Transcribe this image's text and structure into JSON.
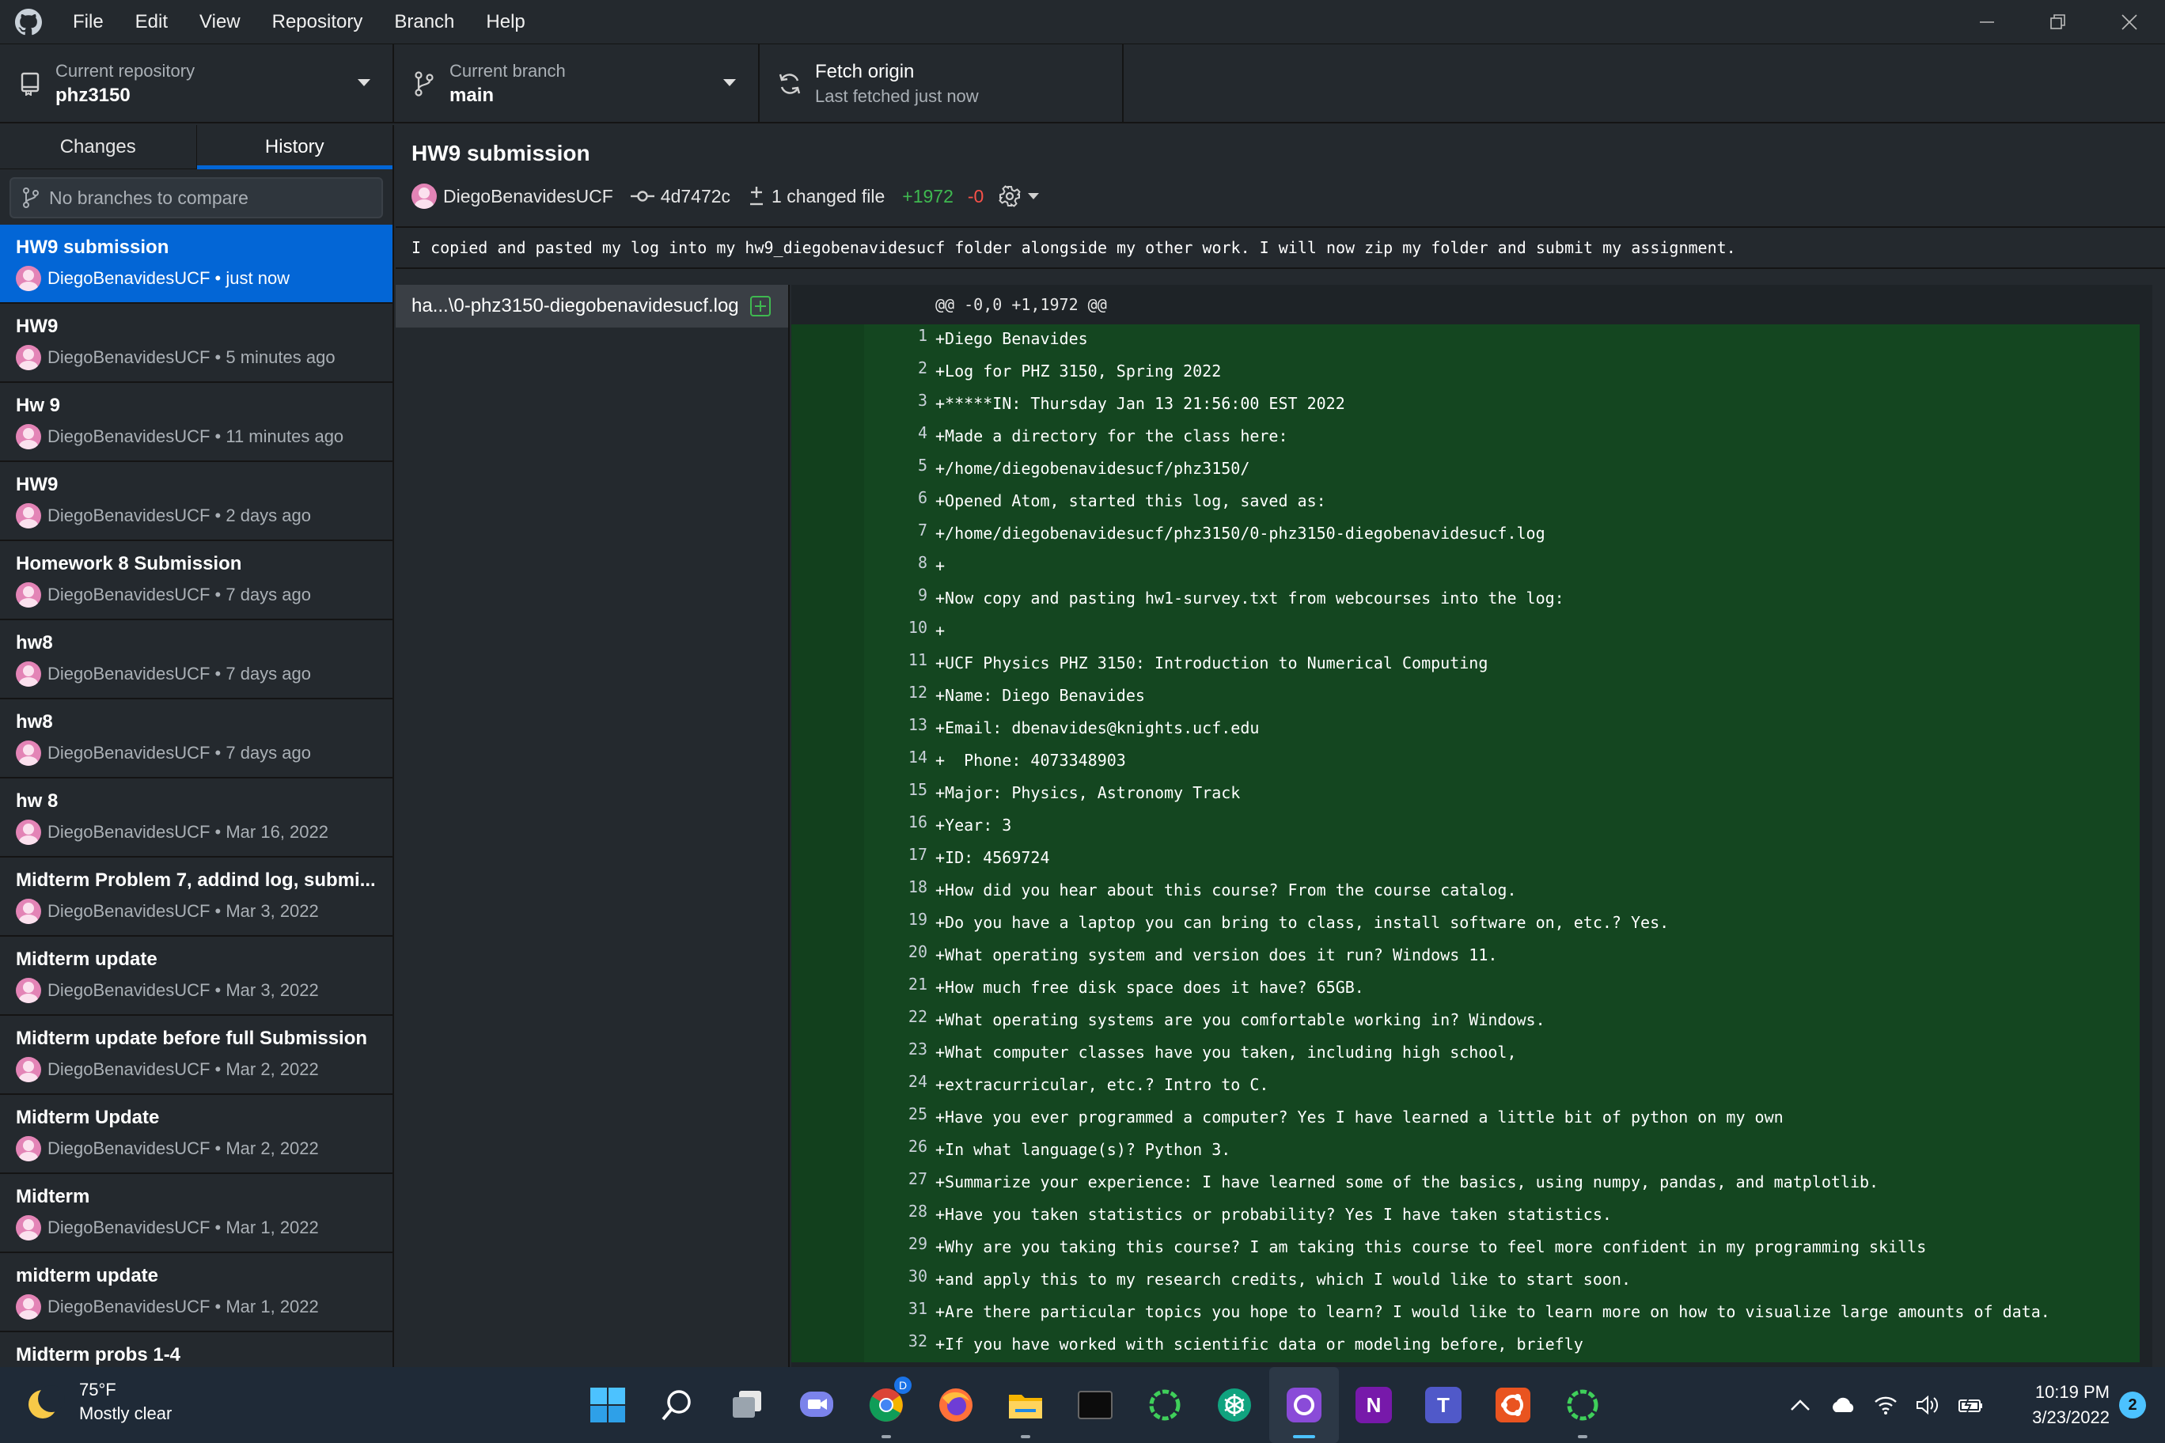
{
  "menu": [
    "File",
    "Edit",
    "View",
    "Repository",
    "Branch",
    "Help"
  ],
  "toolbar": {
    "repo_label": "Current repository",
    "repo_value": "phz3150",
    "branch_label": "Current branch",
    "branch_value": "main",
    "fetch_label": "Fetch origin",
    "fetch_sub": "Last fetched just now"
  },
  "sidebar": {
    "tabs": [
      "Changes",
      "History"
    ],
    "compare_placeholder": "No branches to compare",
    "commits": [
      {
        "title": "HW9 submission",
        "meta": "DiegoBenavidesUCF • just now"
      },
      {
        "title": "HW9",
        "meta": "DiegoBenavidesUCF • 5 minutes ago"
      },
      {
        "title": "Hw 9",
        "meta": "DiegoBenavidesUCF • 11 minutes ago"
      },
      {
        "title": "HW9",
        "meta": "DiegoBenavidesUCF • 2 days ago"
      },
      {
        "title": "Homework 8 Submission",
        "meta": "DiegoBenavidesUCF • 7 days ago"
      },
      {
        "title": "hw8",
        "meta": "DiegoBenavidesUCF • 7 days ago"
      },
      {
        "title": "hw8",
        "meta": "DiegoBenavidesUCF • 7 days ago"
      },
      {
        "title": "hw 8",
        "meta": "DiegoBenavidesUCF • Mar 16, 2022"
      },
      {
        "title": "Midterm Problem 7, addind log, submi...",
        "meta": "DiegoBenavidesUCF • Mar 3, 2022"
      },
      {
        "title": "Midterm update",
        "meta": "DiegoBenavidesUCF • Mar 3, 2022"
      },
      {
        "title": "Midterm update before full Submission",
        "meta": "DiegoBenavidesUCF • Mar 2, 2022"
      },
      {
        "title": "Midterm Update",
        "meta": "DiegoBenavidesUCF • Mar 2, 2022"
      },
      {
        "title": "Midterm",
        "meta": "DiegoBenavidesUCF • Mar 1, 2022"
      },
      {
        "title": "midterm update",
        "meta": "DiegoBenavidesUCF • Mar 1, 2022"
      },
      {
        "title": "Midterm probs 1-4",
        "meta": ""
      }
    ]
  },
  "commit": {
    "title": "HW9 submission",
    "author": "DiegoBenavidesUCF",
    "sha": "4d7472c",
    "changed": "1 changed file",
    "additions": "+1972",
    "deletions": "-0",
    "description": "I copied and pasted my log into my hw9_diegobenavidesucf folder alongside my other work. I will now zip my folder and submit my assignment."
  },
  "files": [
    {
      "name": "ha...\\0-phz3150-diegobenavidesucf.log",
      "status": "added"
    }
  ],
  "diff": {
    "hunk": "@@ -0,0 +1,1972 @@",
    "lines": [
      {
        "n": "1",
        "text": "+Diego Benavides"
      },
      {
        "n": "2",
        "text": "+Log for PHZ 3150, Spring 2022"
      },
      {
        "n": "3",
        "text": "+*****IN: Thursday Jan 13 21:56:00 EST 2022"
      },
      {
        "n": "4",
        "text": "+Made a directory for the class here:"
      },
      {
        "n": "5",
        "text": "+/home/diegobenavidesucf/phz3150/"
      },
      {
        "n": "6",
        "text": "+Opened Atom, started this log, saved as:"
      },
      {
        "n": "7",
        "text": "+/home/diegobenavidesucf/phz3150/0-phz3150-diegobenavidesucf.log"
      },
      {
        "n": "8",
        "text": "+"
      },
      {
        "n": "9",
        "text": "+Now copy and pasting hw1-survey.txt from webcourses into the log:"
      },
      {
        "n": "10",
        "text": "+"
      },
      {
        "n": "11",
        "text": "+UCF Physics PHZ 3150: Introduction to Numerical Computing"
      },
      {
        "n": "12",
        "text": "+Name: Diego Benavides"
      },
      {
        "n": "13",
        "text": "+Email: dbenavides@knights.ucf.edu"
      },
      {
        "n": "14",
        "text": "+  Phone: 4073348903"
      },
      {
        "n": "15",
        "text": "+Major: Physics, Astronomy Track"
      },
      {
        "n": "16",
        "text": "+Year: 3"
      },
      {
        "n": "17",
        "text": "+ID: 4569724"
      },
      {
        "n": "18",
        "text": "+How did you hear about this course? From the course catalog."
      },
      {
        "n": "19",
        "text": "+Do you have a laptop you can bring to class, install software on, etc.? Yes."
      },
      {
        "n": "20",
        "text": "+What operating system and version does it run? Windows 11."
      },
      {
        "n": "21",
        "text": "+How much free disk space does it have? 65GB."
      },
      {
        "n": "22",
        "text": "+What operating systems are you comfortable working in? Windows."
      },
      {
        "n": "23",
        "text": "+What computer classes have you taken, including high school,"
      },
      {
        "n": "24",
        "text": "+extracurricular, etc.? Intro to C."
      },
      {
        "n": "25",
        "text": "+Have you ever programmed a computer? Yes I have learned a little bit of python on my own"
      },
      {
        "n": "26",
        "text": "+In what language(s)? Python 3."
      },
      {
        "n": "27",
        "text": "+Summarize your experience: I have learned some of the basics, using numpy, pandas, and matplotlib."
      },
      {
        "n": "28",
        "text": "+Have you taken statistics or probability? Yes I have taken statistics."
      },
      {
        "n": "29",
        "text": "+Why are you taking this course? I am taking this course to feel more confident in my programming skills"
      },
      {
        "n": "30",
        "text": "+and apply this to my research credits, which I would like to start soon."
      },
      {
        "n": "31",
        "text": "+Are there particular topics you hope to learn? I would like to learn more on how to visualize large amounts of data."
      },
      {
        "n": "32",
        "text": "+If you have worked with scientific data or modeling before, briefly"
      }
    ]
  },
  "taskbar": {
    "weather_temp": "75°F",
    "weather_desc": "Mostly clear",
    "time": "10:19 PM",
    "date": "3/23/2022",
    "notifications": "2",
    "chrome_badge": "D",
    "apps": [
      "start-icon",
      "search-icon",
      "task-view-icon",
      "chat-icon",
      "chrome-icon",
      "firefox-icon",
      "file-explorer-icon",
      "terminal-icon",
      "loader-icon",
      "chatgpt-icon",
      "github-desktop-icon",
      "onenote-icon",
      "teams-icon",
      "ubuntu-icon",
      "loader-icon"
    ]
  },
  "colors": {
    "accent": "#0366d6",
    "diff_add_bg": "#144620",
    "add_text": "#3fb950",
    "del_text": "#f85149"
  }
}
